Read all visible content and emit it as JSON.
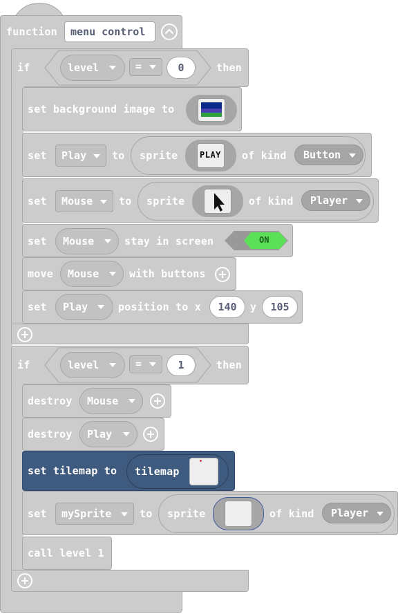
{
  "function_block": {
    "keyword": "function",
    "name": "menu control",
    "collapse_icon": "chevron-up-icon"
  },
  "if1": {
    "keyword": "if",
    "variable": "level",
    "operator": "=",
    "value": "0",
    "then": "then",
    "statements": {
      "set_background": {
        "label": "set background image to",
        "image_icon": "background-image-thumbnail"
      },
      "set_play": {
        "set": "set",
        "variable": "Play",
        "to": "to",
        "sprite": "sprite",
        "sprite_image_text": "PLAY",
        "of_kind": "of kind",
        "kind": "Button"
      },
      "set_mouse": {
        "set": "set",
        "variable": "Mouse",
        "to": "to",
        "sprite": "sprite",
        "sprite_image_icon": "cursor-arrow-icon",
        "of_kind": "of kind",
        "kind": "Player"
      },
      "stay_in_screen": {
        "set": "set",
        "variable": "Mouse",
        "label": "stay in screen",
        "toggle": "ON"
      },
      "move_mouse": {
        "move": "move",
        "variable": "Mouse",
        "label": "with buttons"
      },
      "set_position": {
        "set": "set",
        "variable": "Play",
        "label": "position to x",
        "x": "140",
        "y_label": "y",
        "y": "105"
      }
    }
  },
  "if2": {
    "keyword": "if",
    "variable": "level",
    "operator": "=",
    "value": "1",
    "then": "then",
    "statements": {
      "destroy_mouse": {
        "label": "destroy",
        "variable": "Mouse"
      },
      "destroy_play": {
        "label": "destroy",
        "variable": "Play"
      },
      "set_tilemap": {
        "label": "set tilemap to",
        "inner": "tilemap"
      },
      "set_mysprite": {
        "set": "set",
        "variable": "mySprite",
        "to": "to",
        "sprite": "sprite",
        "of_kind": "of kind",
        "kind": "Player"
      },
      "call_level": {
        "label": "call level 1"
      }
    }
  },
  "colors": {
    "block_gray": "#cccccc",
    "tilemap_block": "#3e5a7e",
    "toggle_on": "#5ce05a",
    "text": "#ffffff"
  }
}
